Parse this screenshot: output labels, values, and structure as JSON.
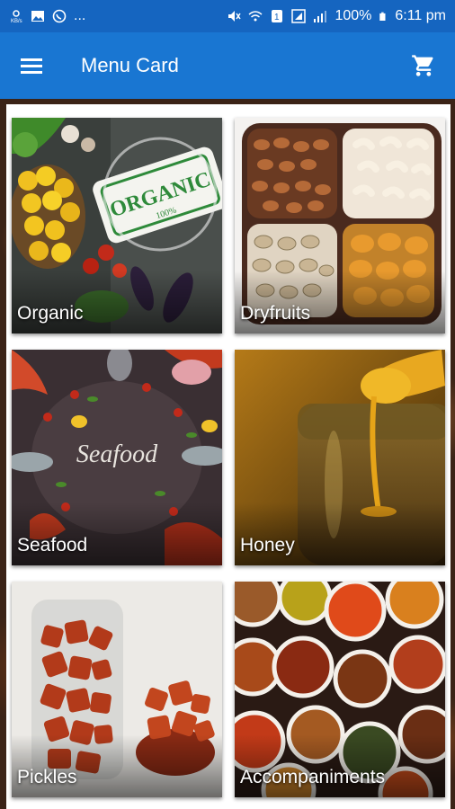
{
  "status_bar": {
    "battery": "100%",
    "time": "6:11 pm",
    "left_icons": [
      "ks-icon",
      "gallery-icon",
      "whatsapp-icon",
      "more-dots"
    ],
    "right_icons": [
      "mute-icon",
      "wifi-icon",
      "data-icon",
      "sim-icon",
      "signal-icon",
      "battery-icon"
    ],
    "more": "..."
  },
  "app_bar": {
    "title": "Menu Card",
    "menu_icon": "hamburger-menu-icon",
    "cart_icon": "shopping-cart-icon",
    "color": "#1976d2"
  },
  "categories": [
    {
      "label": "Organic",
      "image": "organic-vegetables-image"
    },
    {
      "label": "Dryfruits",
      "image": "dryfruits-tray-image"
    },
    {
      "label": "Seafood",
      "image": "seafood-image"
    },
    {
      "label": "Honey",
      "image": "honey-jar-image"
    },
    {
      "label": "Pickles",
      "image": "pickles-jar-image"
    },
    {
      "label": "Accompaniments",
      "image": "accompaniments-bowls-image"
    }
  ],
  "organic_art": {
    "stamp_text": "ORGANIC",
    "stamp_sub": "100%"
  },
  "seafood_art": {
    "script_text": "Seafood"
  }
}
